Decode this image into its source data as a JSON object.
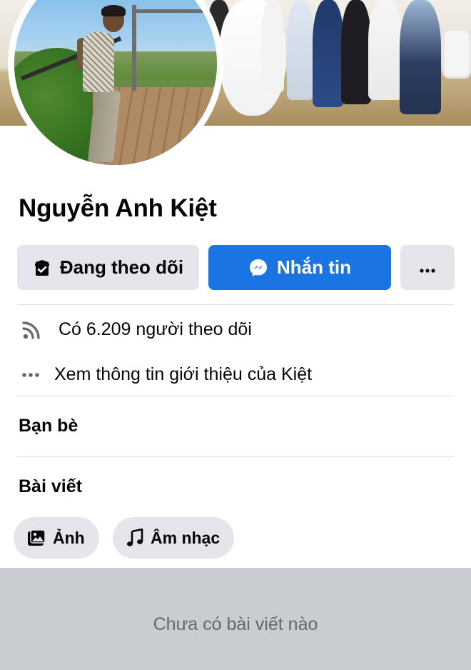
{
  "profile": {
    "name": "Nguyễn Anh Kiệt"
  },
  "actions": {
    "follow_label": "Đang theo dõi",
    "message_label": "Nhắn tin",
    "more_icon": "more-horizontal-icon"
  },
  "info": {
    "followers_text": "Có 6.209 người theo dõi",
    "about_text": "Xem thông tin giới thiệu của Kiệt"
  },
  "sections": {
    "friends_title": "Bạn bè",
    "posts_title": "Bài viết"
  },
  "filters": [
    {
      "label": "Ảnh",
      "icon": "photo-icon"
    },
    {
      "label": "Âm nhạc",
      "icon": "music-note-icon"
    }
  ],
  "feed": {
    "empty_text": "Chưa có bài viết nào"
  },
  "colors": {
    "primary": "#1b74e4",
    "button_gray": "#e4e6eb",
    "feed_bg": "#c9ccd1",
    "secondary_text": "#65676b"
  }
}
